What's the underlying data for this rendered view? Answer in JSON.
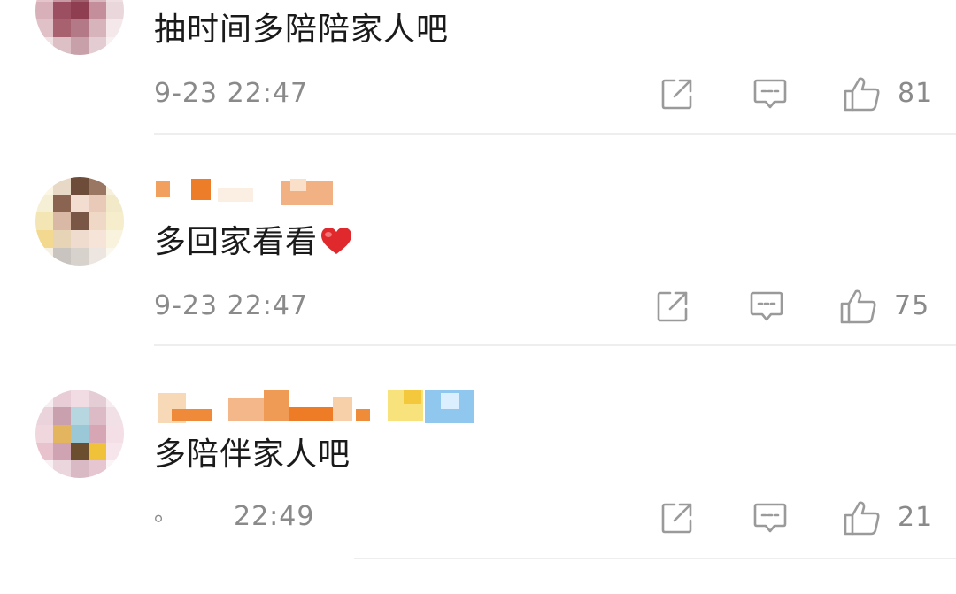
{
  "comments": [
    {
      "text": "抽时间多陪陪家人吧",
      "time": "9-23 22:47",
      "likes": "81"
    },
    {
      "text": "多回家看看",
      "emoji": "red-heart-emoji",
      "time": "9-23 22:47",
      "likes": "75"
    },
    {
      "text": "多陪伴家人吧",
      "date_prefix": "。",
      "time": "22:49",
      "likes": "21"
    }
  ],
  "icons": {
    "share": "share-icon",
    "reply": "comment-icon",
    "like": "thumbs-up-icon"
  },
  "colors": {
    "text": "#1a1a1a",
    "meta": "#8a8a8a",
    "heart": "#e0292c",
    "divider": "#eeeeee"
  }
}
